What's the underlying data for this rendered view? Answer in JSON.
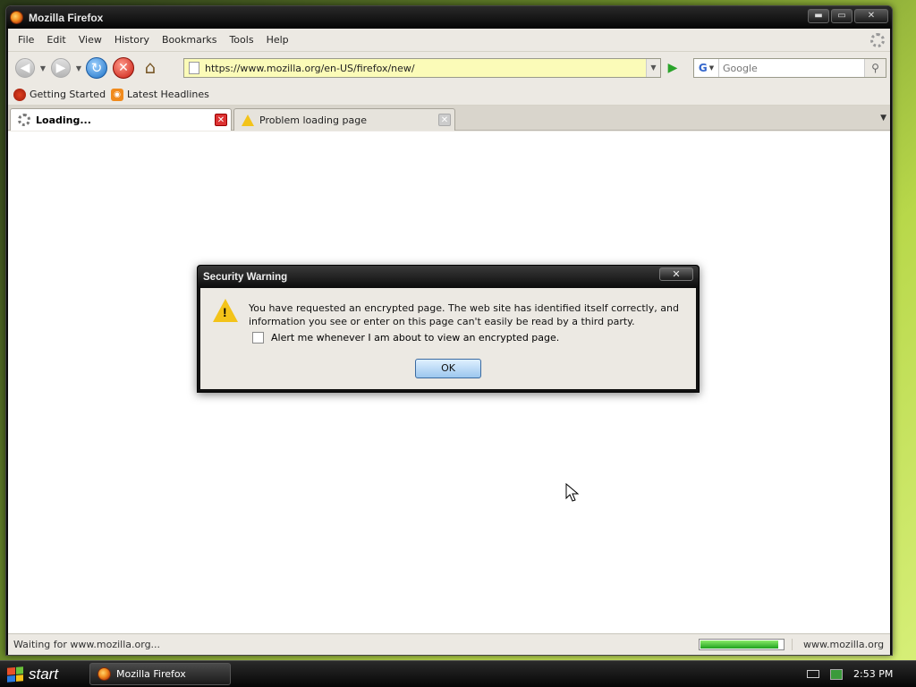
{
  "window": {
    "title": "Mozilla Firefox",
    "controls": {
      "minimize": "▬",
      "maximize": "▭",
      "close": "✕"
    }
  },
  "menubar": {
    "items": [
      {
        "label": "File"
      },
      {
        "label": "Edit"
      },
      {
        "label": "View"
      },
      {
        "label": "History"
      },
      {
        "label": "Bookmarks"
      },
      {
        "label": "Tools"
      },
      {
        "label": "Help"
      }
    ]
  },
  "navbar": {
    "back_icon": "back-arrow-icon",
    "forward_icon": "forward-arrow-icon",
    "url": "https://www.mozilla.org/en-US/firefox/new/",
    "search": {
      "engine": "G",
      "placeholder": "Google"
    }
  },
  "bookmarks": {
    "items": [
      {
        "label": "Getting Started",
        "icon": "getting-started-icon"
      },
      {
        "label": "Latest Headlines",
        "icon": "rss-icon"
      }
    ]
  },
  "tabs": [
    {
      "label": "Loading...",
      "active": true,
      "icon": "loading-spinner-icon"
    },
    {
      "label": "Problem loading page",
      "active": false,
      "icon": "warning-icon"
    }
  ],
  "dialog": {
    "title": "Security Warning",
    "close_label": "✕",
    "message": "You have requested an encrypted page. The web site has identified itself correctly, and information you see or enter on this page can't easily be read by a third party.",
    "checkbox_label": "Alert me whenever I am about to view an encrypted page.",
    "checkbox_checked": false,
    "ok_label": "OK"
  },
  "statusbar": {
    "text": "Waiting for www.mozilla.org...",
    "progress": 0.95,
    "host": "www.mozilla.org"
  },
  "taskbar": {
    "start_label": "start",
    "task_label": "Mozilla Firefox",
    "clock": "2:53 PM"
  },
  "colors": {
    "url_background": "#fbfbb8",
    "progress_green": "#1ea11e",
    "warning_yellow": "#f3c319"
  }
}
